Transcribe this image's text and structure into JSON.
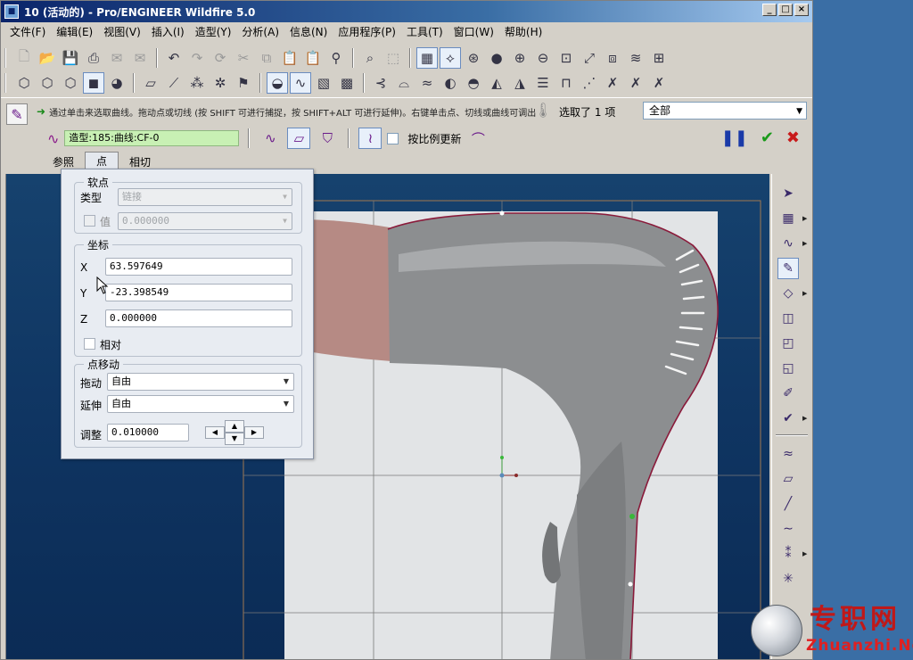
{
  "window": {
    "title": "10 (活动的) - Pro/ENGINEER Wildfire 5.0",
    "buttons": {
      "minimize": "_",
      "maximize": "□",
      "close": "×"
    }
  },
  "menubar": {
    "items": [
      "文件(F)",
      "编辑(E)",
      "视图(V)",
      "插入(I)",
      "造型(Y)",
      "分析(A)",
      "信息(N)",
      "应用程序(P)",
      "工具(T)",
      "窗口(W)",
      "帮助(H)"
    ]
  },
  "dashboard": {
    "message": "通过单击来选取曲线。拖动点或切线 (按 SHIFT 可进行捕捉，按 SHIFT+ALT 可进行延伸)。右键单击点、切线或曲线可调出",
    "selection": {
      "prefix": "选取了",
      "count": "1",
      "suffix": "项"
    },
    "filter": "全部",
    "feature_name": "造型:185:曲线:CF-0",
    "proportional_update": "按比例更新",
    "tabs": [
      "参照",
      "点",
      "相切"
    ],
    "active_tab": "点"
  },
  "points_panel": {
    "soft_point": {
      "title": "软点",
      "type_label": "类型",
      "type_value": "链接",
      "value_label": "值",
      "value_value": "0.000000"
    },
    "coordinates": {
      "title": "坐标",
      "x_label": "X",
      "x_value": "63.597649",
      "y_label": "Y",
      "y_value": "-23.398549",
      "z_label": "Z",
      "z_value": "0.000000",
      "relative_label": "相对"
    },
    "point_move": {
      "title": "点移动",
      "drag_label": "拖动",
      "drag_value": "自由",
      "extend_label": "延伸",
      "extend_value": "自由",
      "adjust_label": "调整",
      "adjust_value": "0.010000"
    }
  },
  "watermark": {
    "cn": "专职网",
    "en": "Zhuanzhi.Net"
  }
}
